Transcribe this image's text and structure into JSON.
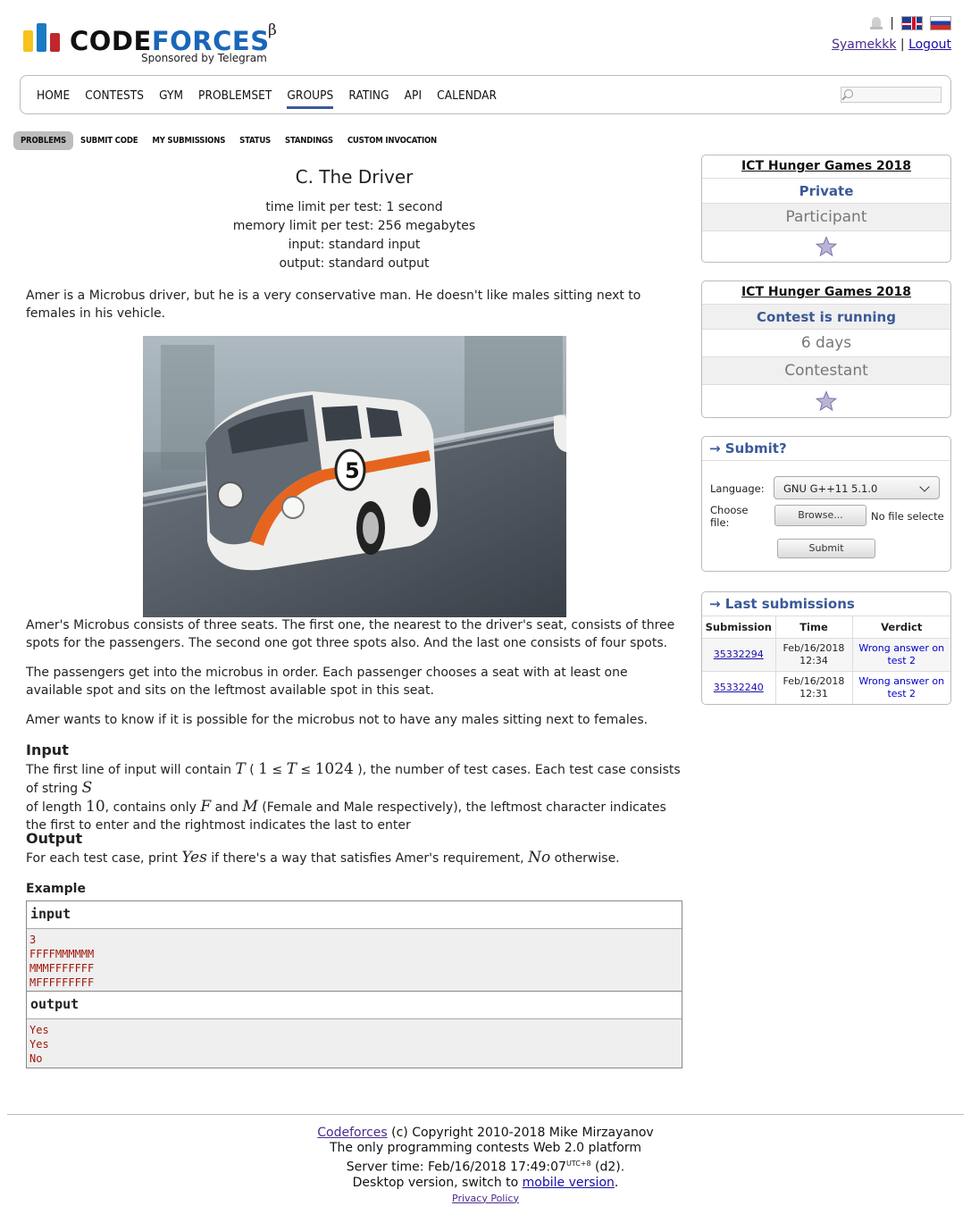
{
  "brand": {
    "logo_word_1": "CODE",
    "logo_word_2": "FORCES",
    "beta": "β",
    "sponsor": "Sponsored by Telegram"
  },
  "user": {
    "separator": "|",
    "username": "Syamekkk",
    "logout": "Logout"
  },
  "nav": {
    "items": [
      "HOME",
      "CONTESTS",
      "GYM",
      "PROBLEMSET",
      "GROUPS",
      "RATING",
      "API",
      "CALENDAR"
    ],
    "active": "GROUPS",
    "search_placeholder": ""
  },
  "subnav": {
    "items": [
      "PROBLEMS",
      "SUBMIT CODE",
      "MY SUBMISSIONS",
      "STATUS",
      "STANDINGS",
      "CUSTOM INVOCATION"
    ],
    "active": "PROBLEMS"
  },
  "problem": {
    "title": "C. The Driver",
    "time_limit": "time limit per test: 1 second",
    "memory_limit": "memory limit per test: 256 megabytes",
    "input_src": "input: standard input",
    "output_src": "output: standard output",
    "p1": "Amer is a Microbus driver, but he is a very conservative man. He doesn't like males sitting next to females in his vehicle.",
    "p2": "Amer's Microbus consists of three seats. The first one, the nearest to the driver's seat, consists of three spots for the passengers. The second one got three spots also. And the last one consists of four spots.",
    "p3": "The passengers get into the microbus in order. Each passenger chooses a seat with at least one available spot and sits on the leftmost available spot in this seat.",
    "p4": "Amer wants to know if it is possible for the microbus not to have any males sitting next to females.",
    "input_title": "Input",
    "input_text": {
      "a": "The first line of input will contain ",
      "T": "T",
      "b": " ( ",
      "one": "1",
      "le1": " ≤ ",
      "T2": "T",
      "le2": " ≤ ",
      "max": "1024",
      "c": " ), the number of test cases. Each test case consists of string ",
      "S": "S",
      "d": "of length ",
      "ten": "10",
      "e": ", contains only ",
      "F": "F",
      "f": " and ",
      "M": "M",
      "g": " (Female and Male respectively), the leftmost character indicates the first to enter and the rightmost indicates the last to enter"
    },
    "output_title": "Output",
    "output_text": {
      "a": "For each test case, print ",
      "yes": "Yes",
      "b": " if there's a way that satisfies Amer's requirement, ",
      "no": "No",
      "c": " otherwise."
    },
    "example_title": "Example",
    "sample_input_label": "input",
    "sample_input": "3\nFFFFMMMMMM\nMMMFFFFFFF\nMFFFFFFFFF",
    "sample_output_label": "output",
    "sample_output": "Yes\nYes\nNo",
    "image_number": "5"
  },
  "sidebar": {
    "box1": {
      "contest": "ICT Hunger Games 2018",
      "status": "Private",
      "role": "Participant"
    },
    "box2": {
      "contest": "ICT Hunger Games 2018",
      "status": "Contest is running",
      "remaining": "6 days",
      "role": "Contestant"
    },
    "submit": {
      "caption": "→ Submit?",
      "language_label": "Language:",
      "language_value": "GNU G++11 5.1.0",
      "file_label": "Choose file:",
      "browse": "Browse...",
      "no_file": "No file selecte",
      "submit_btn": "Submit"
    },
    "last": {
      "caption": "→ Last submissions",
      "headers": [
        "Submission",
        "Time",
        "Verdict"
      ],
      "rows": [
        {
          "id": "35332294",
          "time": "Feb/16/2018 12:34",
          "verdict": "Wrong answer on test 2"
        },
        {
          "id": "35332240",
          "time": "Feb/16/2018 12:31",
          "verdict": "Wrong answer on test 2"
        }
      ]
    }
  },
  "footer": {
    "brand": "Codeforces",
    "copyright": " (c) Copyright 2010-2018 Mike Mirzayanov",
    "tagline": "The only programming contests Web 2.0 platform",
    "server_time": "Server time: Feb/16/2018 17:49:07",
    "tz": "UTC+8",
    "server_suffix": " (d2).",
    "desktop": "Desktop version, switch to ",
    "mobile": "mobile version",
    "period": ".",
    "privacy": "Privacy Policy"
  }
}
